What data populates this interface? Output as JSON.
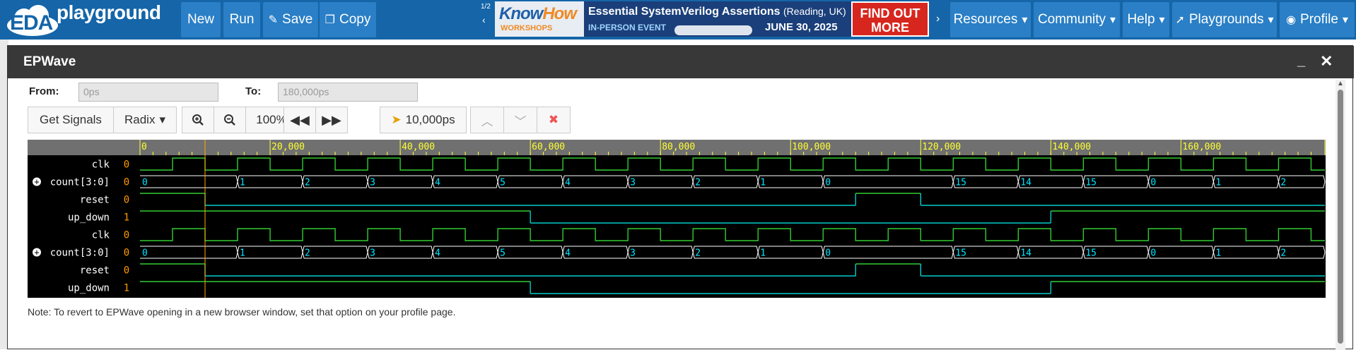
{
  "navbar": {
    "logo_eda": "EDA",
    "logo_playground": "playground",
    "buttons": {
      "new": "New",
      "run": "Run",
      "save": "Save",
      "copy": "Copy"
    },
    "ad": {
      "page": "1/2",
      "brand": "KnowHow",
      "brand_sub": "WORKSHOPS",
      "headline": "Essential SystemVerilog Assertions",
      "location": "(Reading, UK)",
      "event_type": "IN-PERSON EVENT",
      "date": "JUNE 30, 2025",
      "cta": "FIND OUT MORE"
    },
    "menus": {
      "resources": "Resources",
      "community": "Community",
      "help": "Help",
      "playgrounds": "Playgrounds",
      "profile": "Profile"
    }
  },
  "epwave": {
    "title": "EPWave",
    "from_label": "From:",
    "from_value": "0ps",
    "to_label": "To:",
    "to_value": "180,000ps",
    "toolbar": {
      "get_signals": "Get Signals",
      "radix": "Radix",
      "zoom": "100%",
      "step": "10,000ps"
    },
    "note": "Note: To revert to EPWave opening in a new browser window, set that option on your profile page."
  },
  "waveform": {
    "time_range_ps": [
      0,
      180000
    ],
    "cursor_ps": 10000,
    "major_ticks": [
      0,
      20000,
      40000,
      60000,
      80000,
      100000,
      120000,
      140000,
      160000
    ],
    "major_tick_labels": [
      "0",
      "20,000",
      "40,000",
      "60,000",
      "80,000",
      "100,000",
      "120,000",
      "140,000",
      "160,000"
    ],
    "clock_period_ps": 10000,
    "clock_first_rise_ps": 5000,
    "colors": {
      "clock": "#33cc33",
      "bus": "#ffffff",
      "bus_text": "#00e5ff",
      "low": "#00cccc",
      "high": "#33cc33",
      "value": "#ff9900",
      "ruler": "#ffff33",
      "cursor": "#ffaa00"
    },
    "signals": [
      {
        "name": "clk",
        "value": "0",
        "kind": "clock",
        "expandable": false
      },
      {
        "name": "count[3:0]",
        "value": "0",
        "kind": "bus",
        "expandable": true
      },
      {
        "name": "reset",
        "value": "0",
        "kind": "bit",
        "expandable": false
      },
      {
        "name": "up_down",
        "value": "1",
        "kind": "bit",
        "expandable": false
      },
      {
        "name": "clk",
        "value": "0",
        "kind": "clock",
        "expandable": false
      },
      {
        "name": "count[3:0]",
        "value": "0",
        "kind": "bus",
        "expandable": true
      },
      {
        "name": "reset",
        "value": "0",
        "kind": "bit",
        "expandable": false
      },
      {
        "name": "up_down",
        "value": "1",
        "kind": "bit",
        "expandable": false
      }
    ],
    "count_changes": [
      {
        "t": 0,
        "v": "0"
      },
      {
        "t": 15000,
        "v": "1"
      },
      {
        "t": 25000,
        "v": "2"
      },
      {
        "t": 35000,
        "v": "3"
      },
      {
        "t": 45000,
        "v": "4"
      },
      {
        "t": 55000,
        "v": "5"
      },
      {
        "t": 65000,
        "v": "4"
      },
      {
        "t": 75000,
        "v": "3"
      },
      {
        "t": 85000,
        "v": "2"
      },
      {
        "t": 95000,
        "v": "1"
      },
      {
        "t": 105000,
        "v": "0"
      },
      {
        "t": 125000,
        "v": "15"
      },
      {
        "t": 135000,
        "v": "14"
      },
      {
        "t": 145000,
        "v": "15"
      },
      {
        "t": 155000,
        "v": "0"
      },
      {
        "t": 165000,
        "v": "1"
      },
      {
        "t": 175000,
        "v": "2"
      }
    ],
    "reset_changes": [
      {
        "t": 0,
        "v": 1
      },
      {
        "t": 10000,
        "v": 0
      },
      {
        "t": 110000,
        "v": 1
      },
      {
        "t": 120000,
        "v": 0
      }
    ],
    "up_down_changes": [
      {
        "t": 0,
        "v": 1
      },
      {
        "t": 60000,
        "v": 0
      },
      {
        "t": 140000,
        "v": 1
      }
    ]
  }
}
